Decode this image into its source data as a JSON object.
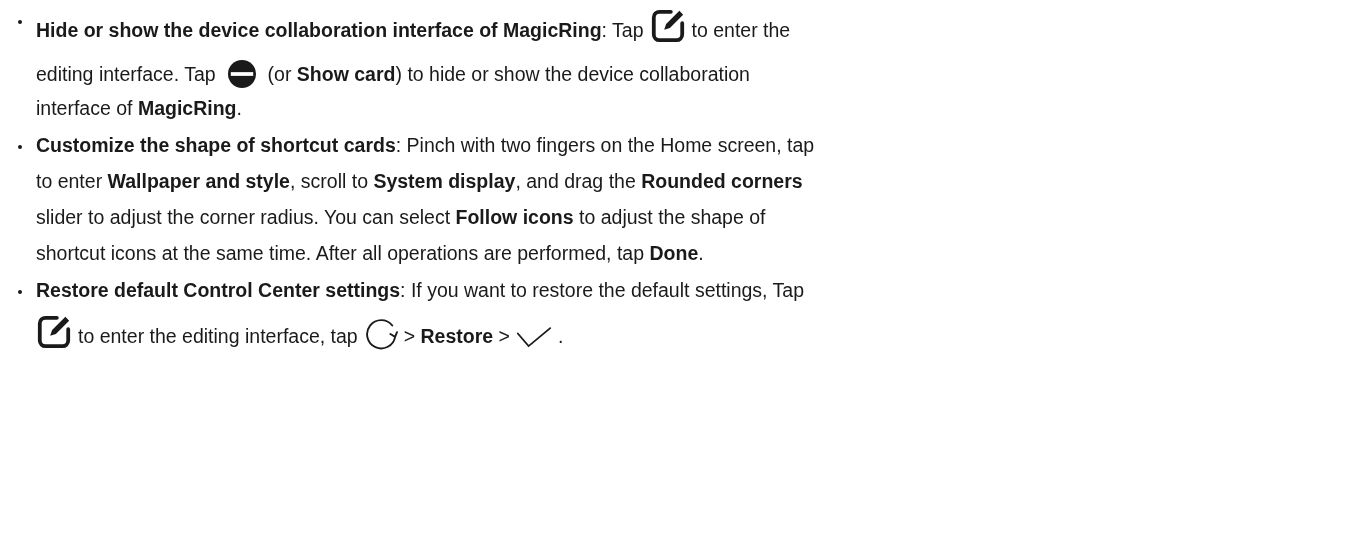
{
  "items": [
    {
      "lines": [
        [
          {
            "kind": "text",
            "text": "**Hide or show the device collaboration interface of MagicRing**: Tap"
          },
          {
            "kind": "edit"
          },
          {
            "kind": "text",
            "text": "to enter the"
          }
        ],
        [
          {
            "kind": "text",
            "text": "editing interface. Tap"
          },
          {
            "kind": "minus"
          },
          {
            "kind": "text",
            "text": "(or **Show card**) to hide or show the device collaboration"
          }
        ],
        [
          {
            "kind": "text",
            "text": "interface of **MagicRing**."
          }
        ]
      ]
    },
    {
      "lines": [
        [
          {
            "kind": "text",
            "text": "**Customize the shape of shortcut cards**: Pinch with two fingers on the Home screen, tap"
          }
        ],
        [
          {
            "kind": "text",
            "text": "to enter **Wallpaper and style**, scroll to **System display**, and drag the **Rounded corners**"
          }
        ],
        [
          {
            "kind": "text",
            "text": "slider to adjust the corner radius. You can select **Follow icons** to adjust the shape of"
          }
        ],
        [
          {
            "kind": "text",
            "text": "shortcut icons at the same time. After all operations are performed, tap **Done**."
          }
        ]
      ]
    },
    {
      "lines": [
        [
          {
            "kind": "text",
            "text": "**Restore default Control Center settings**: If you want to restore the default settings, Tap"
          }
        ],
        [
          {
            "kind": "edit"
          },
          {
            "kind": "text",
            "text": "to enter the editing interface, tap"
          },
          {
            "kind": "refresh"
          },
          {
            "kind": "text",
            "text": "> **Restore** >"
          },
          {
            "kind": "check"
          },
          {
            "kind": "text",
            "text": "."
          }
        ]
      ]
    }
  ]
}
